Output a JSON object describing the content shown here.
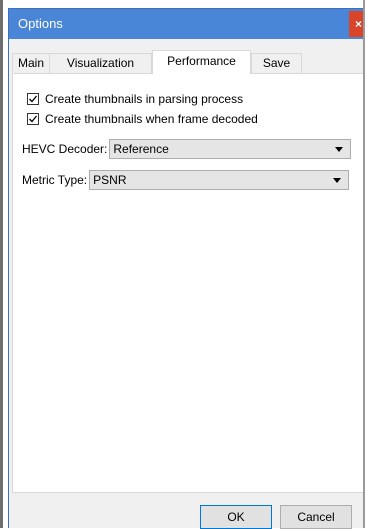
{
  "window": {
    "title": "Options",
    "close_symbol": "×"
  },
  "tabs": [
    {
      "label": "Main",
      "selected": false
    },
    {
      "label": "Visualization",
      "selected": false
    },
    {
      "label": "Performance",
      "selected": true
    },
    {
      "label": "Save",
      "selected": false
    }
  ],
  "performance": {
    "thumbnails_parsing": {
      "label": "Create thumbnails in parsing process",
      "checked": true
    },
    "thumbnails_decoded": {
      "label": "Create thumbnails when frame decoded",
      "checked": true
    },
    "hevc_decoder": {
      "label": "HEVC Decoder:",
      "value": "Reference"
    },
    "metric_type": {
      "label": "Metric Type:",
      "value": "PSNR"
    }
  },
  "buttons": {
    "ok": "OK",
    "cancel": "Cancel"
  },
  "colors": {
    "titlebar": "#4a86d8",
    "close": "#d9452b",
    "default_button_border": "#0078d7"
  },
  "icons": {
    "close": "close-icon",
    "check": "checkmark-icon",
    "dropdown": "chevron-down-icon"
  }
}
